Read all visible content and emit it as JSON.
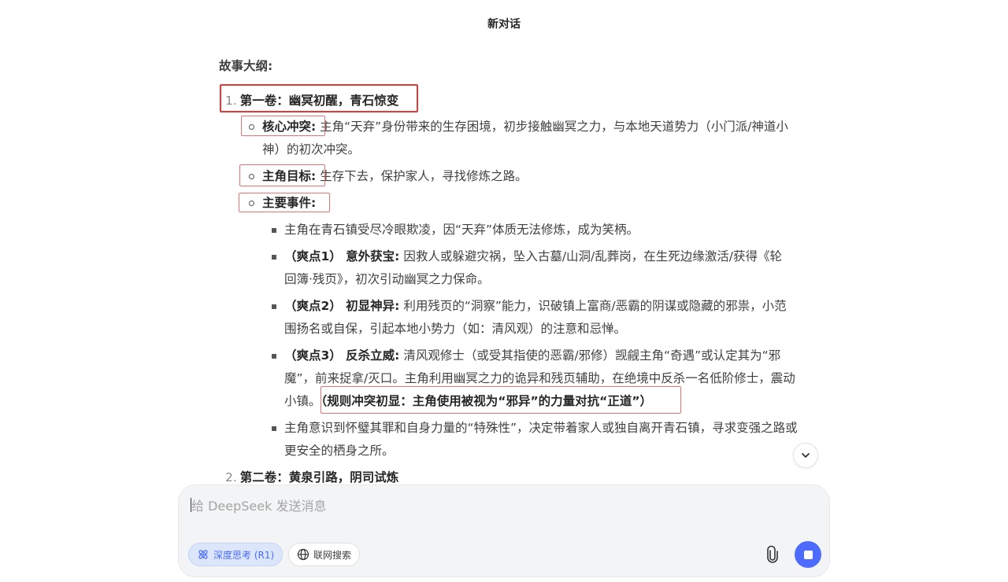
{
  "header": {
    "title": "新对话"
  },
  "outline": {
    "heading": "故事大纲:",
    "volume1": {
      "num": "1.",
      "title": "第一卷：幽冥初醒，青石惊变",
      "conflict_label": "核心冲突:",
      "conflict_text_1": "主角“天弃”身份带来的生存困境，初步接触幽冥之力，与本地天道势力（小门派/神道小",
      "conflict_text_2": "神）的初次冲突。",
      "goal_label": "主角目标:",
      "goal_text": "生存下去，保护家人，寻找修炼之路。",
      "events_label": "主要事件:",
      "events": [
        {
          "label": "",
          "text_1": "主角在青石镇受尽冷眼欺凌，因“天弃”体质无法修炼，成为笑柄。",
          "text_2": ""
        },
        {
          "label": "（爽点1） 意外获宝:",
          "text_1": "因救人或躲避灾祸，坠入古墓/山洞/乱葬岗，在生死边缘激活/获得《轮",
          "text_2": "回簿·残页》，初次引动幽冥之力保命。"
        },
        {
          "label": "（爽点2） 初显神异:",
          "text_1": "利用残页的“洞察”能力，识破镇上富商/恶霸的阴谋或隐藏的邪祟，小范",
          "text_2": "围扬名或自保，引起本地小势力（如：清风观）的注意和忌惮。"
        },
        {
          "label": "（爽点3） 反杀立威:",
          "text_1": "清风观修士（或受其指使的恶霸/邪修）觊觎主角“奇遇”或认定其为“邪",
          "text_2": "魔”，前来捉拿/灭口。主角利用幽冥之力的诡异和残页辅助，在绝境中反杀一名低阶修士，震动",
          "text_3": "小镇。",
          "highlight": "（规则冲突初显：主角使用被视为“邪异”的力量对抗“正道”）"
        },
        {
          "label": "",
          "text_1": "主角意识到怀璧其罪和自身力量的“特殊性”，决定带着家人或独自离开青石镇，寻求变强之路或",
          "text_2": "更安全的栖身之所。"
        }
      ]
    },
    "volume2": {
      "num": "2.",
      "title": "第二卷：黄泉引路，阴司试炼"
    }
  },
  "input": {
    "placeholder": "给 DeepSeek 发送消息",
    "deep_think_label": "深度思考 (R1)",
    "web_search_label": "联网搜索"
  },
  "icons": {
    "scroll": "chevron-down-icon",
    "deep": "atom-icon",
    "web": "globe-icon",
    "attach": "paperclip-icon",
    "stop": "stop-icon"
  },
  "colors": {
    "accent": "#4d6bfe",
    "highlight_box": "#e53935"
  }
}
